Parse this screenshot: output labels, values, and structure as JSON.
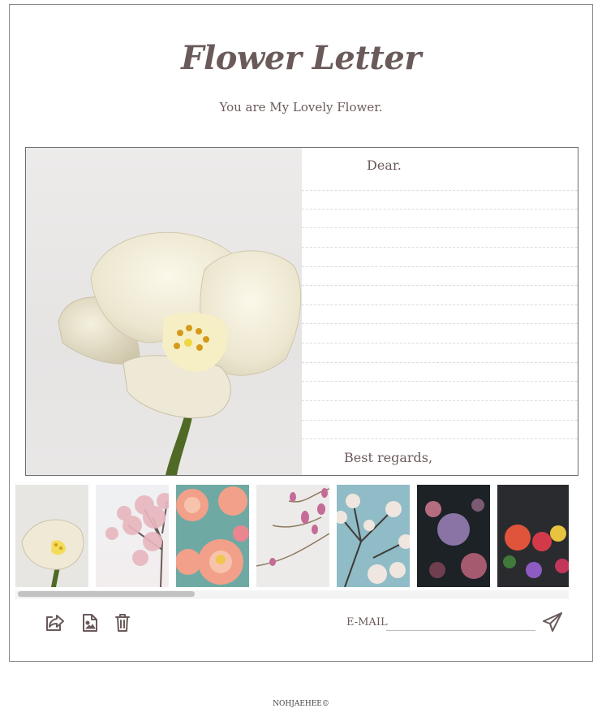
{
  "header": {
    "title": "Flower Letter",
    "subtitle": "You are My Lovely Flower."
  },
  "letter": {
    "greeting": "Dear.",
    "closing": "Best regards,",
    "main_image": "white-tulip"
  },
  "gallery": {
    "thumbnails": [
      {
        "name": "white-tulip"
      },
      {
        "name": "pink-cherry-blossom-tree"
      },
      {
        "name": "coral-dahlias"
      },
      {
        "name": "pink-bud-branch"
      },
      {
        "name": "blue-sky-blossom-branches"
      },
      {
        "name": "dark-hydrangea-bouquet"
      },
      {
        "name": "dark-red-flower-bouquet"
      }
    ],
    "scroll_position": 0
  },
  "toolbar": {
    "share_icon": "share-icon",
    "image_file_icon": "image-file-icon",
    "trash_icon": "trash-icon",
    "email_label": "E-MAIL",
    "email_value": "",
    "email_placeholder": "",
    "send_icon": "send-icon"
  },
  "footer": {
    "credit": "NOHJAEHEE©"
  },
  "colors": {
    "text": "#6b5a5a",
    "border": "#8a8a8a",
    "rule": "#dcdcdc"
  }
}
